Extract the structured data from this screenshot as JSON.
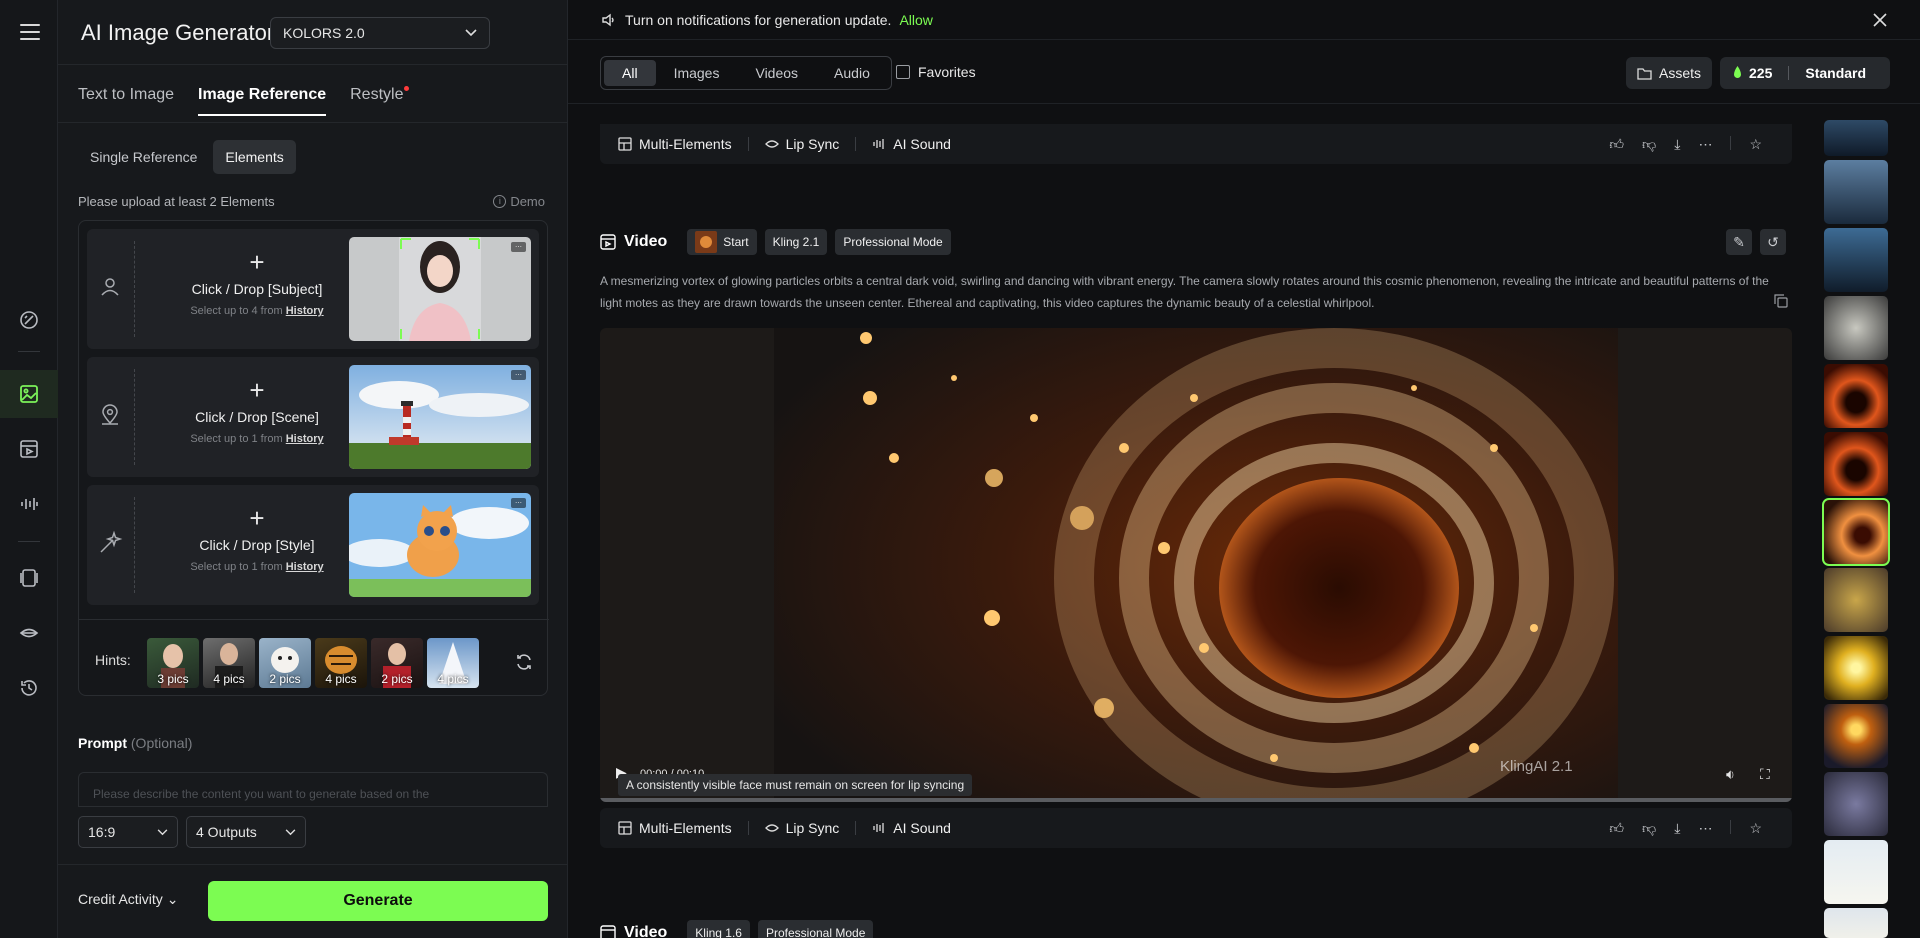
{
  "panel": {
    "title": "AI Image Generator",
    "model": "KOLORS 2.0",
    "tabs": [
      {
        "label": "Text to Image"
      },
      {
        "label": "Image Reference"
      },
      {
        "label": "Restyle"
      }
    ],
    "subtabs": [
      {
        "label": "Single Reference"
      },
      {
        "label": "Elements"
      }
    ],
    "upload_note": "Please upload at least 2 Elements",
    "demo": "Demo",
    "elements": [
      {
        "action": "Click / Drop [Subject]",
        "select_prefix": "Select up to 4 from",
        "history": "History"
      },
      {
        "action": "Click / Drop [Scene]",
        "select_prefix": "Select up to 1 from",
        "history": "History"
      },
      {
        "action": "Click / Drop [Style]",
        "select_prefix": "Select up to 1 from",
        "history": "History"
      }
    ],
    "hints_label": "Hints:",
    "hints": [
      "3 pics",
      "4 pics",
      "2 pics",
      "4 pics",
      "2 pics",
      "4 pics"
    ],
    "prompt_label": "Prompt",
    "prompt_optional": "(Optional)",
    "prompt_placeholder": "Please describe the content you want to generate based on the",
    "ratio": "16:9",
    "outputs": "4 Outputs",
    "credit_activity": "Credit Activity",
    "generate": "Generate"
  },
  "main": {
    "notification": "Turn on notifications for generation update.",
    "allow": "Allow",
    "filters": [
      "All",
      "Images",
      "Videos",
      "Audio"
    ],
    "favorites": "Favorites",
    "assets": "Assets",
    "credits": "225",
    "plan": "Standard",
    "tools": {
      "multi": "Multi-Elements",
      "lip": "Lip Sync",
      "sound": "AI Sound"
    },
    "video_label": "Video",
    "chips": {
      "start": "Start",
      "model": "Kling 2.1",
      "mode": "Professional Mode"
    },
    "next_chips": {
      "model": "Kling 1.6",
      "mode": "Professional Mode"
    },
    "description": "A mesmerizing vortex of glowing particles orbits a central dark void, swirling and dancing with vibrant energy. The camera slowly rotates around this cosmic phenomenon, revealing the intricate and beautiful patterns of the light motes as they are drawn towards the unseen center. Ethereal and captivating, this video captures the dynamic beauty of a celestial whirlpool.",
    "time": "00:00 / 00:10",
    "tooltip": "A consistently visible face must remain on screen for lip syncing",
    "watermark": "KlingAI 2.1"
  }
}
